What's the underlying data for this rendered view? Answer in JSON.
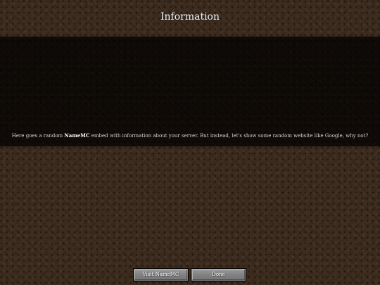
{
  "screen": {
    "title": "Information",
    "message": {
      "before": "Here goes a random ",
      "highlight": "NameMC",
      "after": " embed with information about your server. But instead, let's show some random website like Google, why not?"
    },
    "buttons": {
      "visit_label": "Visit NameMC",
      "done_label": "Done"
    }
  }
}
